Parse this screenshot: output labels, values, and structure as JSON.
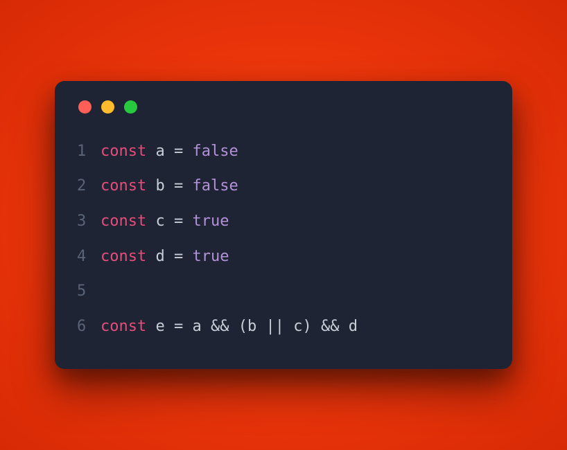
{
  "window": {
    "traffic_lights": [
      "close",
      "minimize",
      "zoom"
    ]
  },
  "code": {
    "lines": [
      {
        "num": "1",
        "tokens": [
          {
            "kind": "keyword",
            "text": "const"
          },
          {
            "kind": "space",
            "text": " "
          },
          {
            "kind": "ident",
            "text": "a"
          },
          {
            "kind": "space",
            "text": " "
          },
          {
            "kind": "op",
            "text": "="
          },
          {
            "kind": "space",
            "text": " "
          },
          {
            "kind": "bool",
            "text": "false"
          }
        ]
      },
      {
        "num": "2",
        "tokens": [
          {
            "kind": "keyword",
            "text": "const"
          },
          {
            "kind": "space",
            "text": " "
          },
          {
            "kind": "ident",
            "text": "b"
          },
          {
            "kind": "space",
            "text": " "
          },
          {
            "kind": "op",
            "text": "="
          },
          {
            "kind": "space",
            "text": " "
          },
          {
            "kind": "bool",
            "text": "false"
          }
        ]
      },
      {
        "num": "3",
        "tokens": [
          {
            "kind": "keyword",
            "text": "const"
          },
          {
            "kind": "space",
            "text": " "
          },
          {
            "kind": "ident",
            "text": "c"
          },
          {
            "kind": "space",
            "text": " "
          },
          {
            "kind": "op",
            "text": "="
          },
          {
            "kind": "space",
            "text": " "
          },
          {
            "kind": "bool",
            "text": "true"
          }
        ]
      },
      {
        "num": "4",
        "tokens": [
          {
            "kind": "keyword",
            "text": "const"
          },
          {
            "kind": "space",
            "text": " "
          },
          {
            "kind": "ident",
            "text": "d"
          },
          {
            "kind": "space",
            "text": " "
          },
          {
            "kind": "op",
            "text": "="
          },
          {
            "kind": "space",
            "text": " "
          },
          {
            "kind": "bool",
            "text": "true"
          }
        ]
      },
      {
        "num": "5",
        "tokens": []
      },
      {
        "num": "6",
        "tokens": [
          {
            "kind": "keyword",
            "text": "const"
          },
          {
            "kind": "space",
            "text": " "
          },
          {
            "kind": "ident",
            "text": "e"
          },
          {
            "kind": "space",
            "text": " "
          },
          {
            "kind": "op",
            "text": "="
          },
          {
            "kind": "space",
            "text": " "
          },
          {
            "kind": "ident",
            "text": "a"
          },
          {
            "kind": "space",
            "text": " "
          },
          {
            "kind": "op",
            "text": "&&"
          },
          {
            "kind": "space",
            "text": " "
          },
          {
            "kind": "paren",
            "text": "("
          },
          {
            "kind": "ident",
            "text": "b"
          },
          {
            "kind": "space",
            "text": " "
          },
          {
            "kind": "op",
            "text": "||"
          },
          {
            "kind": "space",
            "text": " "
          },
          {
            "kind": "ident",
            "text": "c"
          },
          {
            "kind": "paren",
            "text": ")"
          },
          {
            "kind": "space",
            "text": " "
          },
          {
            "kind": "op",
            "text": "&&"
          },
          {
            "kind": "space",
            "text": " "
          },
          {
            "kind": "ident",
            "text": "d"
          }
        ]
      }
    ]
  }
}
